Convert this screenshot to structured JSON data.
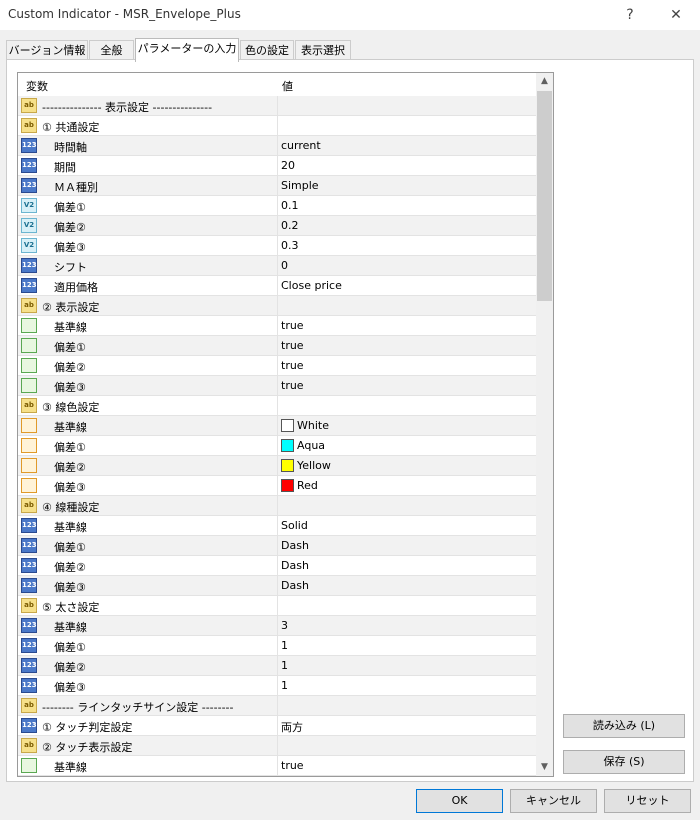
{
  "window": {
    "title": "Custom Indicator - MSR_Envelope_Plus",
    "help": "?",
    "close": "✕"
  },
  "tabs": [
    {
      "label": "バージョン情報"
    },
    {
      "label": "全般"
    },
    {
      "label": "パラメーターの入力"
    },
    {
      "label": "色の設定"
    },
    {
      "label": "表示選択"
    }
  ],
  "active_tab": "パラメーターの入力",
  "table": {
    "col_variable": "変数",
    "col_value": "値",
    "rows": [
      {
        "type": "ab",
        "indent": false,
        "name": "--------------- 表示設定 ---------------",
        "value": ""
      },
      {
        "type": "ab",
        "indent": false,
        "name": "① 共通設定",
        "value": ""
      },
      {
        "type": "int",
        "indent": true,
        "name": "時間軸",
        "value": "current"
      },
      {
        "type": "int",
        "indent": true,
        "name": "期間",
        "value": "20"
      },
      {
        "type": "int",
        "indent": true,
        "name": "ＭＡ種別",
        "value": "Simple"
      },
      {
        "type": "dbl",
        "indent": true,
        "name": "偏差①",
        "value": "0.1"
      },
      {
        "type": "dbl",
        "indent": true,
        "name": "偏差②",
        "value": "0.2"
      },
      {
        "type": "dbl",
        "indent": true,
        "name": "偏差③",
        "value": "0.3"
      },
      {
        "type": "int",
        "indent": true,
        "name": "シフト",
        "value": "0"
      },
      {
        "type": "int",
        "indent": true,
        "name": "適用価格",
        "value": "Close price"
      },
      {
        "type": "ab",
        "indent": false,
        "name": "② 表示設定",
        "value": ""
      },
      {
        "type": "bool",
        "indent": true,
        "name": "基準線",
        "value": "true"
      },
      {
        "type": "bool",
        "indent": true,
        "name": "偏差①",
        "value": "true"
      },
      {
        "type": "bool",
        "indent": true,
        "name": "偏差②",
        "value": "true"
      },
      {
        "type": "bool",
        "indent": true,
        "name": "偏差③",
        "value": "true"
      },
      {
        "type": "ab",
        "indent": false,
        "name": "③ 線色設定",
        "value": ""
      },
      {
        "type": "color",
        "indent": true,
        "name": "基準線",
        "value": "White",
        "swatch": "#ffffff"
      },
      {
        "type": "color",
        "indent": true,
        "name": "偏差①",
        "value": "Aqua",
        "swatch": "#00ffff"
      },
      {
        "type": "color",
        "indent": true,
        "name": "偏差②",
        "value": "Yellow",
        "swatch": "#ffff00"
      },
      {
        "type": "color",
        "indent": true,
        "name": "偏差③",
        "value": "Red",
        "swatch": "#ff0000"
      },
      {
        "type": "ab",
        "indent": false,
        "name": "④ 線種設定",
        "value": ""
      },
      {
        "type": "int",
        "indent": true,
        "name": "基準線",
        "value": "Solid"
      },
      {
        "type": "int",
        "indent": true,
        "name": "偏差①",
        "value": "Dash"
      },
      {
        "type": "int",
        "indent": true,
        "name": "偏差②",
        "value": "Dash"
      },
      {
        "type": "int",
        "indent": true,
        "name": "偏差③",
        "value": "Dash"
      },
      {
        "type": "ab",
        "indent": false,
        "name": "⑤ 太さ設定",
        "value": ""
      },
      {
        "type": "int",
        "indent": true,
        "name": "基準線",
        "value": "3"
      },
      {
        "type": "int",
        "indent": true,
        "name": "偏差①",
        "value": "1"
      },
      {
        "type": "int",
        "indent": true,
        "name": "偏差②",
        "value": "1"
      },
      {
        "type": "int",
        "indent": true,
        "name": "偏差③",
        "value": "1"
      },
      {
        "type": "ab",
        "indent": false,
        "name": "-------- ラインタッチサイン設定 --------",
        "value": ""
      },
      {
        "type": "int",
        "indent": false,
        "name": "① タッチ判定設定",
        "value": "両方"
      },
      {
        "type": "ab",
        "indent": false,
        "name": "② タッチ表示設定",
        "value": ""
      },
      {
        "type": "bool",
        "indent": true,
        "name": "基準線",
        "value": "true"
      }
    ]
  },
  "icon_text": {
    "ab": "ab",
    "int": "123",
    "dbl": "V2",
    "bool": "",
    "color": ""
  },
  "side_buttons": {
    "load": "読み込み (L)",
    "save": "保存 (S)"
  },
  "footer_buttons": {
    "ok": "OK",
    "cancel": "キャンセル",
    "reset": "リセット"
  }
}
